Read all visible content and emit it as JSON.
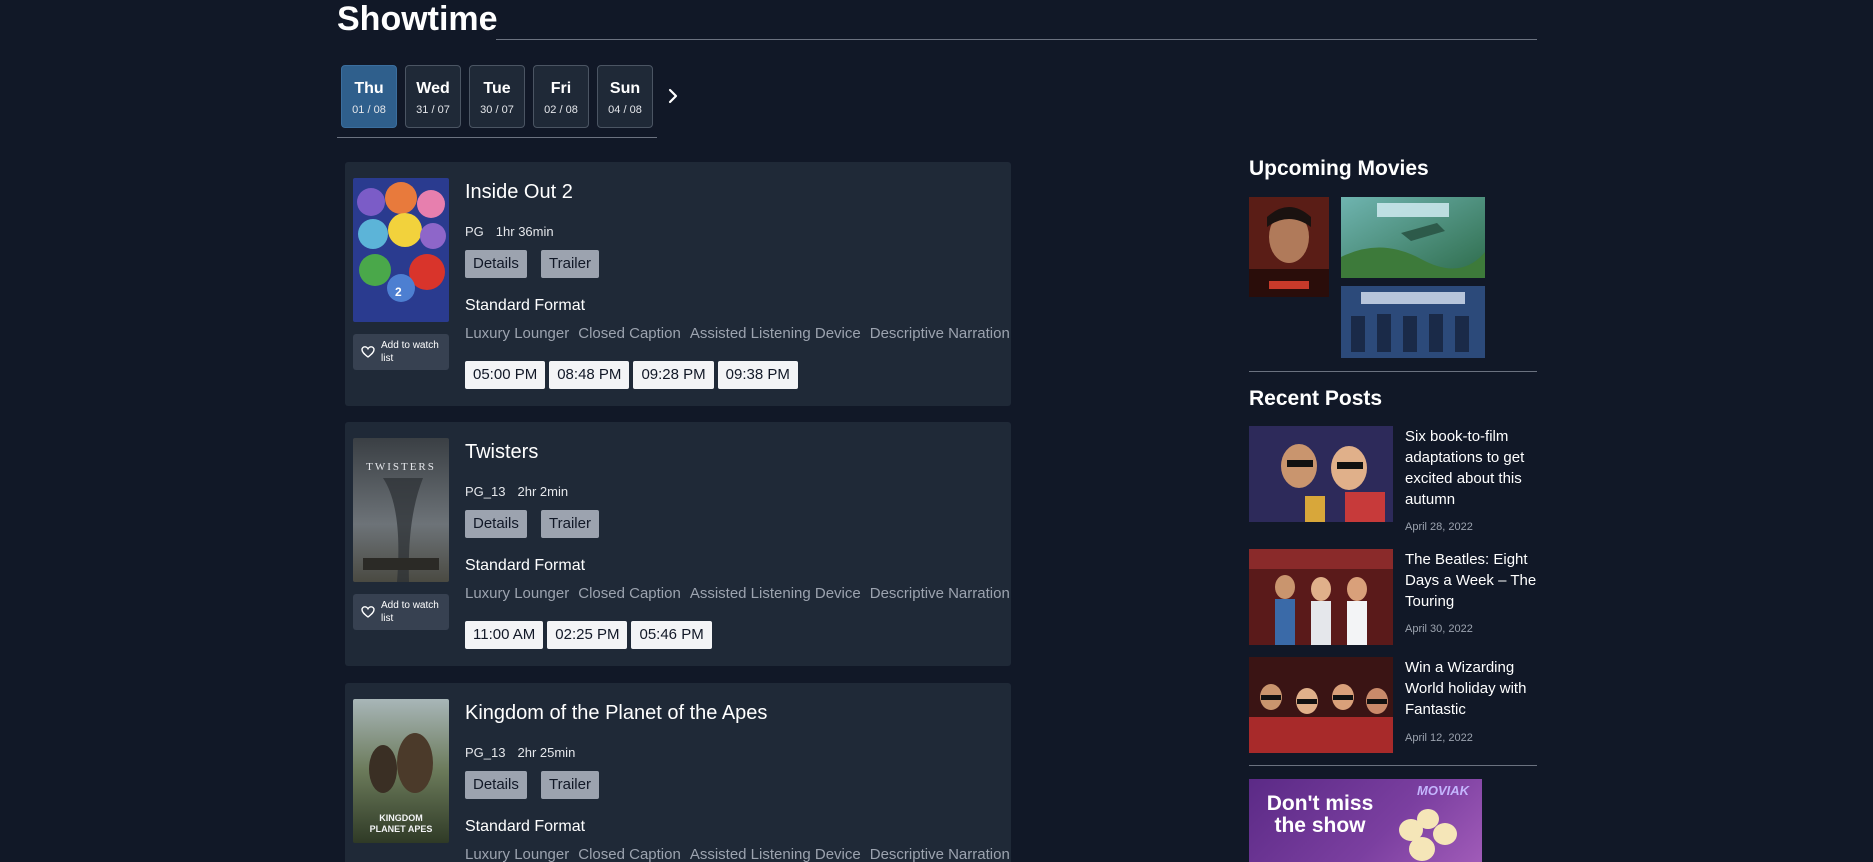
{
  "header": {
    "title": "Showtime"
  },
  "days": [
    {
      "name": "Thu",
      "date": "01 / 08",
      "active": true
    },
    {
      "name": "Wed",
      "date": "31 / 07",
      "active": false
    },
    {
      "name": "Tue",
      "date": "30 / 07",
      "active": false
    },
    {
      "name": "Fri",
      "date": "02 / 08",
      "active": false
    },
    {
      "name": "Sun",
      "date": "04 / 08",
      "active": false
    }
  ],
  "movies": [
    {
      "title": "Inside Out 2",
      "rating": "PG",
      "duration": "1hr 36min",
      "details_label": "Details",
      "trailer_label": "Trailer",
      "watch_label": "Add to watch list",
      "format": "Standard Format",
      "features": [
        "Luxury Lounger",
        "Closed Caption",
        "Assisted Listening Device",
        "Descriptive Narration"
      ],
      "times": [
        "05:00 PM",
        "08:48 PM",
        "09:28 PM",
        "09:38 PM"
      ]
    },
    {
      "title": "Twisters",
      "rating": "PG_13",
      "duration": "2hr 2min",
      "details_label": "Details",
      "trailer_label": "Trailer",
      "watch_label": "Add to watch list",
      "format": "Standard Format",
      "features": [
        "Luxury Lounger",
        "Closed Caption",
        "Assisted Listening Device",
        "Descriptive Narration"
      ],
      "times": [
        "11:00 AM",
        "02:25 PM",
        "05:46 PM"
      ]
    },
    {
      "title": "Kingdom of the Planet of the Apes",
      "rating": "PG_13",
      "duration": "2hr 25min",
      "details_label": "Details",
      "trailer_label": "Trailer",
      "format": "Standard Format",
      "features": [
        "Luxury Lounger",
        "Closed Caption",
        "Assisted Listening Device",
        "Descriptive Narration"
      ]
    }
  ],
  "sidebar": {
    "upcoming_title": "Upcoming Movies",
    "recent_title": "Recent Posts",
    "posts": [
      {
        "title": "Six book-to-film adaptations to get excited about this autumn",
        "date": "April 28, 2022"
      },
      {
        "title": "The Beatles: Eight Days a Week – The Touring",
        "date": "April 30, 2022"
      },
      {
        "title": "Win a Wizarding World holiday with Fantastic",
        "date": "April 12, 2022"
      }
    ],
    "ad": {
      "text": "Don't miss the show",
      "logo": "MOVIAK"
    }
  }
}
